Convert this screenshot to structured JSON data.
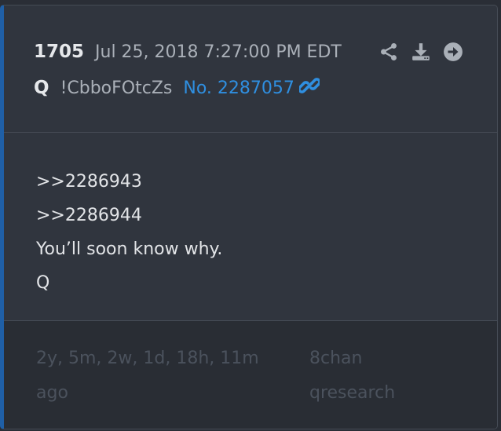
{
  "post": {
    "number": "1705",
    "date": "Jul 25, 2018 7:27:00 PM EDT",
    "author": "Q",
    "tripcode": "!CbboFOtcZs",
    "post_link": "No. 2287057"
  },
  "icons": {
    "share": "share-icon",
    "download": "download-icon",
    "goto": "arrow-circle-right-icon",
    "link": "link-icon"
  },
  "body": {
    "lines": [
      ">>2286943",
      ">>2286944",
      "You’ll soon know why.",
      "Q"
    ]
  },
  "footer": {
    "age_line1": "2y, 5m, 2w, 1d, 18h, 11m",
    "age_line2": "ago",
    "board_line1": "8chan",
    "board_line2": "qresearch"
  },
  "colors": {
    "accent": "#1f5fa6",
    "link": "#2f8fe0",
    "background": "#30353e"
  }
}
